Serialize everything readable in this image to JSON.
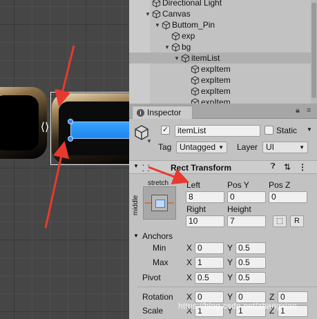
{
  "hierarchy": {
    "rows": [
      {
        "label": "Directional Light",
        "depth": 1,
        "arrow": ""
      },
      {
        "label": "Canvas",
        "depth": 1,
        "arrow": "▼"
      },
      {
        "label": "Buttom_Pin",
        "depth": 2,
        "arrow": "▼"
      },
      {
        "label": "exp",
        "depth": 3,
        "arrow": ""
      },
      {
        "label": "bg",
        "depth": 3,
        "arrow": "▼"
      },
      {
        "label": "itemList",
        "depth": 4,
        "arrow": "▼",
        "selected": true
      },
      {
        "label": "expItem",
        "depth": 5,
        "arrow": ""
      },
      {
        "label": "expItem",
        "depth": 5,
        "arrow": ""
      },
      {
        "label": "expItem",
        "depth": 5,
        "arrow": ""
      },
      {
        "label": "expItem",
        "depth": 5,
        "arrow": ""
      }
    ]
  },
  "inspector": {
    "tab_label": "Inspector",
    "object_name": "itemList",
    "active_checked": true,
    "static_label": "Static",
    "tag_label": "Tag",
    "tag_value": "Untagged",
    "layer_label": "Layer",
    "layer_value": "UI"
  },
  "rect_transform": {
    "title": "Rect Transform",
    "anchor_h": "stretch",
    "anchor_v": "middle",
    "labels": {
      "left": "Left",
      "pos_y": "Pos Y",
      "pos_z": "Pos Z",
      "right": "Right",
      "height": "Height"
    },
    "values": {
      "left": "8",
      "pos_y": "0",
      "pos_z": "0",
      "right": "10",
      "height": "7"
    },
    "blueprint_btn": "⬚",
    "raw_btn": "R",
    "anchors_label": "Anchors",
    "min_label": "Min",
    "max_label": "Max",
    "min_x": "0",
    "min_y": "0.5",
    "max_x": "1",
    "max_y": "0.5",
    "pivot_label": "Pivot",
    "pivot_x": "0.5",
    "pivot_y": "0.5",
    "rotation_label": "Rotation",
    "rotation_x": "0",
    "rotation_y": "0",
    "rotation_z": "0",
    "scale_label": "Scale",
    "scale_x": "1",
    "scale_y": "1",
    "scale_z": "1",
    "axis_x": "X",
    "axis_y": "Y",
    "axis_z": "Z"
  },
  "watermark": "https://blog.csdn.net/zhangxiao",
  "colors": {
    "accent_blue": "#1e86ee",
    "arrow_red": "#e8392f",
    "selection": "#b0b0b0"
  }
}
